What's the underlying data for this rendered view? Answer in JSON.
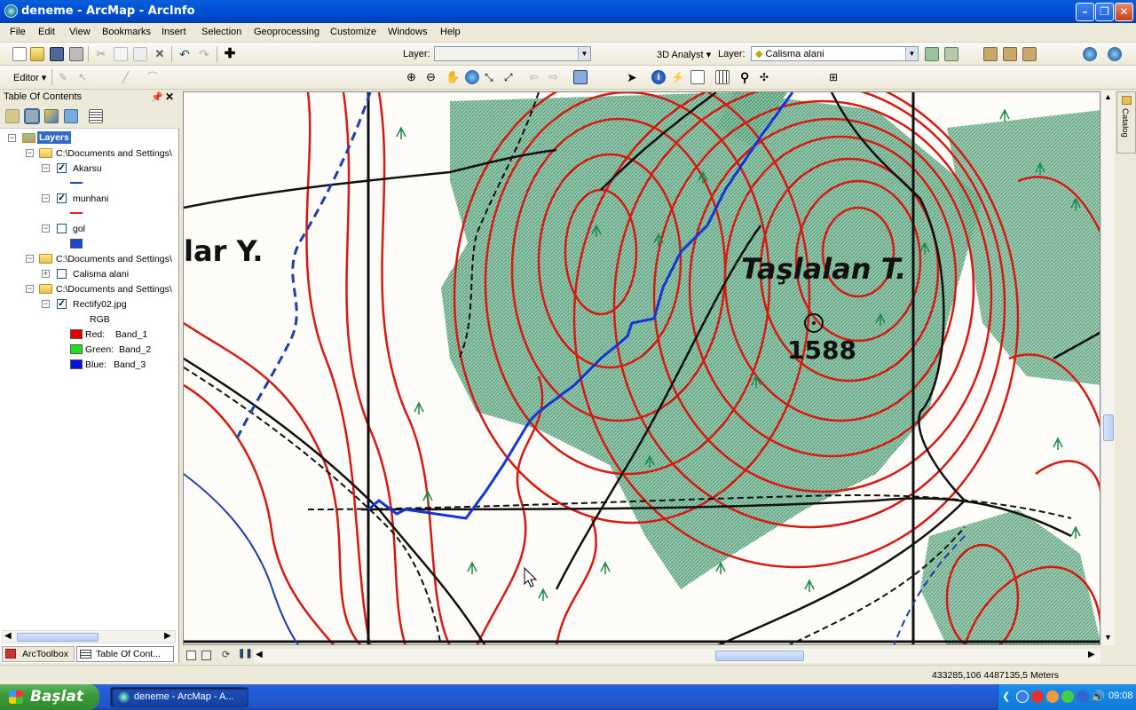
{
  "window": {
    "title": "deneme - ArcMap - ArcInfo"
  },
  "menu": [
    "File",
    "Edit",
    "View",
    "Bookmarks",
    "Insert",
    "Selection",
    "Geoprocessing",
    "Customize",
    "Windows",
    "Help"
  ],
  "toolbar": {
    "layer_label": "Layer:",
    "layer_value": "",
    "analyst_label": "3D Analyst ▾",
    "analyst_layer_label": "Layer:",
    "analyst_layer_value": "Calisma alani",
    "editor_label": "Editor ▾"
  },
  "toc": {
    "title": "Table Of Contents",
    "root": "Layers",
    "groups": [
      {
        "path": "C:\\Documents and Settings\\",
        "layers": [
          {
            "name": "Akarsu",
            "checked": true,
            "color": "#1f3fc7"
          },
          {
            "name": "munhani",
            "checked": true,
            "color": "#e02020"
          },
          {
            "name": "gol",
            "checked": false,
            "color": "#1a47d0"
          }
        ]
      },
      {
        "path": "C:\\Documents and Settings\\",
        "layers": [
          {
            "name": "Calisma alani",
            "checked": false
          }
        ]
      },
      {
        "path": "C:\\Documents and Settings\\",
        "layers": [
          {
            "name": "Rectify02.jpg",
            "checked": true
          }
        ]
      }
    ],
    "raster": {
      "mode": "RGB",
      "bands": [
        {
          "label": "Red:",
          "band": "Band_1",
          "color": "#e00000"
        },
        {
          "label": "Green:",
          "band": "Band_2",
          "color": "#20e020"
        },
        {
          "label": "Blue:",
          "band": "Band_3",
          "color": "#0010e0"
        }
      ]
    },
    "tabs": [
      "ArcToolbox",
      "Table Of Cont..."
    ]
  },
  "map": {
    "labels": [
      "lar Y.",
      "Taşlalan T.",
      "1588"
    ]
  },
  "catalog_label": "Catalog",
  "status": {
    "coords": "433285,106  4487135,5 Meters"
  },
  "taskbar": {
    "start": "Başlat",
    "task": "deneme - ArcMap - A...",
    "clock": "09:08"
  }
}
